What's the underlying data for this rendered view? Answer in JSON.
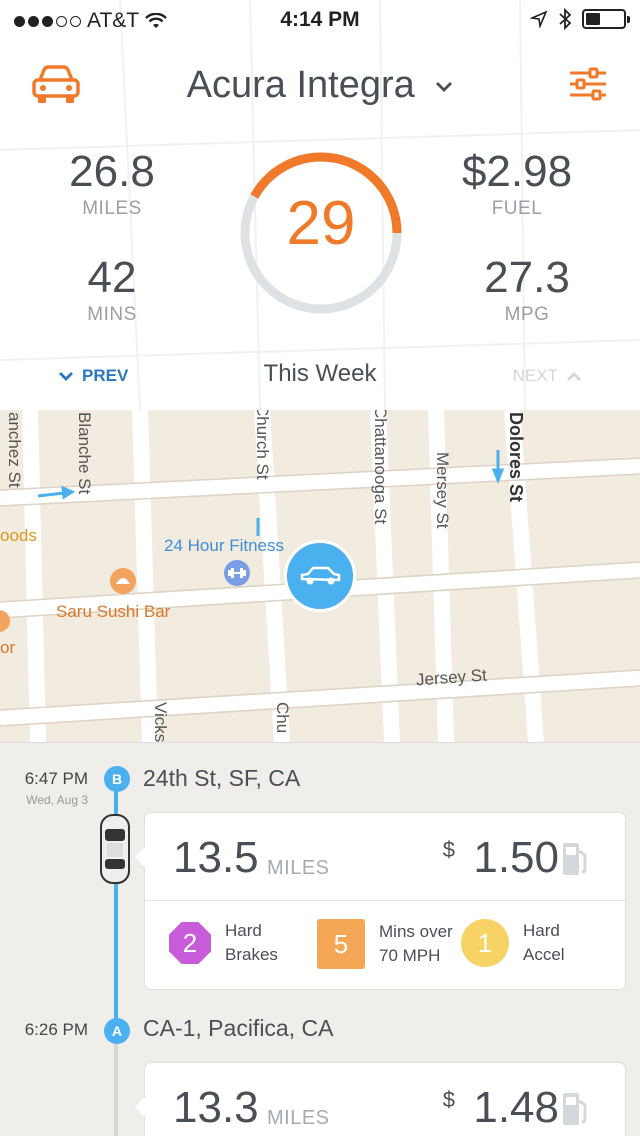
{
  "status_bar": {
    "carrier": "AT&T",
    "time": "4:14 PM"
  },
  "header": {
    "vehicle": "Acura Integra"
  },
  "summary": {
    "miles": {
      "value": "26.8",
      "label": "MILES"
    },
    "mins": {
      "value": "42",
      "label": "MINS"
    },
    "fuel": {
      "value": "$2.98",
      "label": "FUEL"
    },
    "mpg": {
      "value": "27.3",
      "label": "MPG"
    },
    "score": "29",
    "score_progress": 0.42,
    "period": "This Week",
    "prev_label": "PREV",
    "next_label": "NEXT"
  },
  "map": {
    "streets": [
      "anchez St",
      "Blanche St",
      "Church St",
      "Chattanooga St",
      "Mersey St",
      "Dolores St",
      "Jersey St",
      "Vicks",
      "Chu"
    ],
    "places": [
      "oods",
      "24 Hour Fitness",
      "Saru Sushi Bar",
      "or"
    ]
  },
  "trips": [
    {
      "time": "6:47 PM",
      "date": "Wed, Aug 3",
      "badge": "B",
      "address": "24th St, SF, CA",
      "miles": "13.5",
      "miles_label": "MILES",
      "cost_sign": "$",
      "cost": "1.50",
      "events": [
        {
          "count": "2",
          "line1": "Hard",
          "line2": "Brakes"
        },
        {
          "count": "5",
          "line1": "Mins over",
          "line2": "70 MPH"
        },
        {
          "count": "1",
          "line1": "Hard",
          "line2": "Accel"
        }
      ]
    },
    {
      "time": "6:26 PM",
      "badge": "A",
      "address": "CA-1, Pacifica, CA",
      "miles": "13.3",
      "miles_label": "MILES",
      "cost_sign": "$",
      "cost": "1.48"
    }
  ],
  "colors": {
    "accent_orange": "#f07a2a",
    "blue": "#4ab0ee",
    "brake_purple": "#c85bd9",
    "speed_orange": "#f6a756",
    "accel_yellow": "#f7d265"
  }
}
